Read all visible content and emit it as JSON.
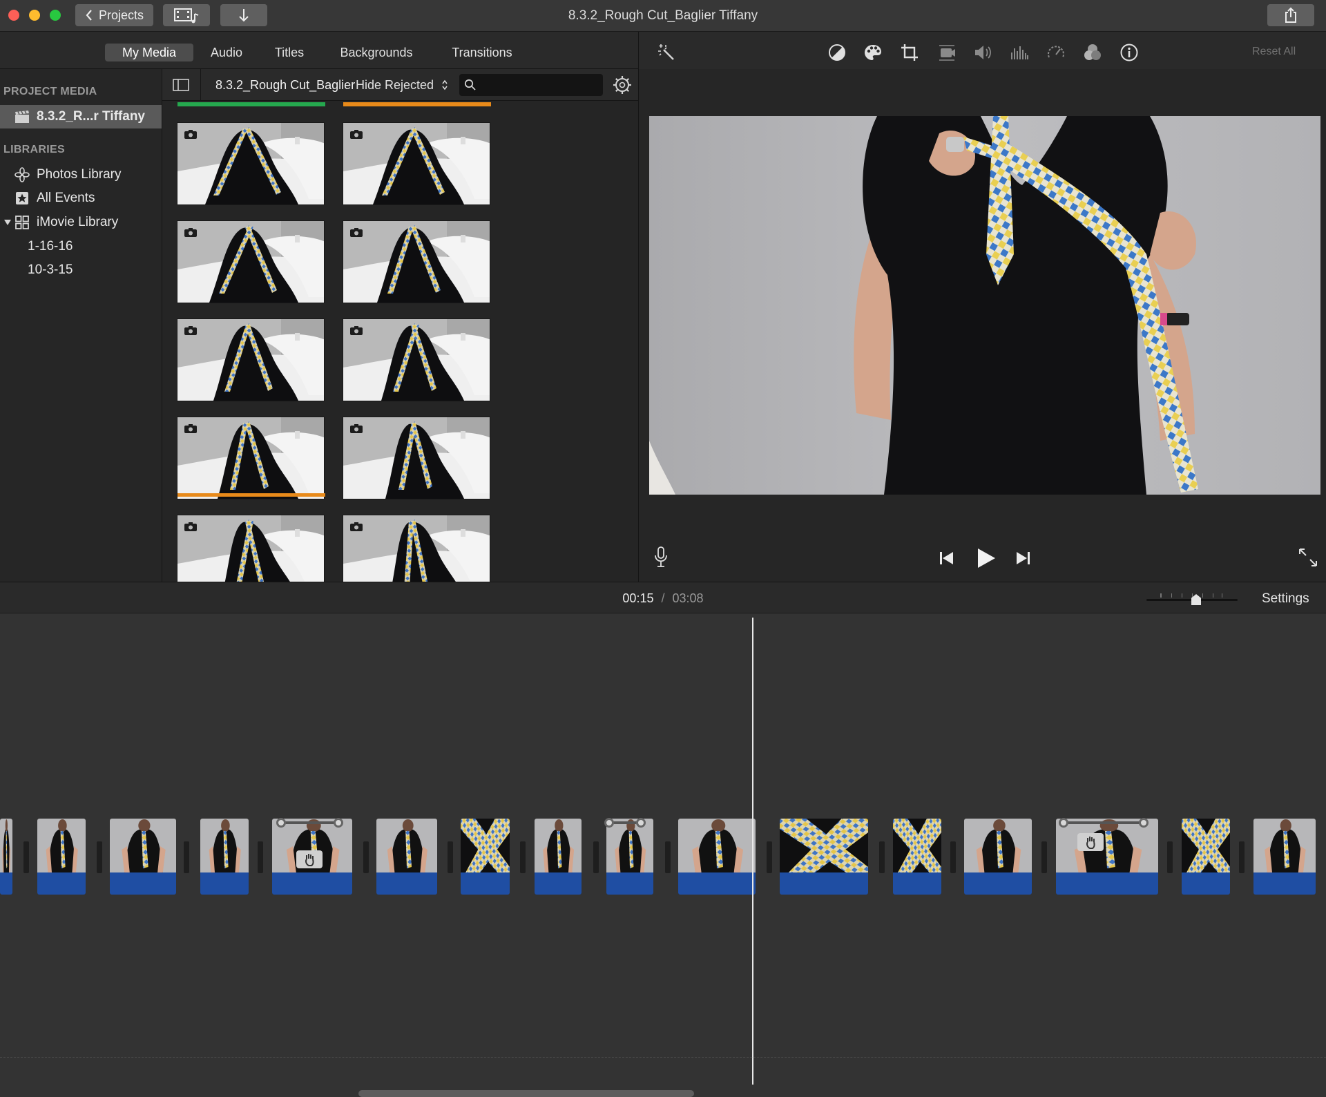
{
  "window": {
    "title": "8.3.2_Rough Cut_Baglier Tiffany",
    "projects_button": "Projects",
    "colors": {
      "close": "#fe5f57",
      "minimize": "#febc2e",
      "zoom": "#28c840"
    }
  },
  "media_tabs": [
    {
      "label": "My Media",
      "active": true
    },
    {
      "label": "Audio",
      "active": false
    },
    {
      "label": "Titles",
      "active": false
    },
    {
      "label": "Backgrounds",
      "active": false
    },
    {
      "label": "Transitions",
      "active": false
    }
  ],
  "sidebar": {
    "project_media_heading": "PROJECT MEDIA",
    "project_item": "8.3.2_R...r Tiffany",
    "libraries_heading": "LIBRARIES",
    "libraries": [
      {
        "label": "Photos Library",
        "icon": "photos-flower-icon"
      },
      {
        "label": "All Events",
        "icon": "star-icon"
      },
      {
        "label": "iMovie Library",
        "icon": "grid-icon"
      }
    ],
    "events": [
      "1-16-16",
      "10-3-15"
    ]
  },
  "browser": {
    "project_name": "8.3.2_Rough Cut_Baglier",
    "filter": "Hide Rejected",
    "search_placeholder": ""
  },
  "viewer_toolbar": {
    "reset_all": "Reset All",
    "icons": [
      "magic-wand-icon",
      "color-balance-icon",
      "color-palette-icon",
      "crop-icon",
      "stabilization-camera-icon",
      "volume-icon",
      "equalizer-icon",
      "speed-gauge-icon",
      "filter-circles-icon",
      "info-icon"
    ]
  },
  "timeline_bar": {
    "current_time": "00:15",
    "separator": "/",
    "total_time": "03:08",
    "settings": "Settings",
    "zoom_level": 0.55
  },
  "accent": {
    "audio_blue": "#1f4ea3",
    "marker_green": "#25a84e",
    "marker_orange": "#e88a1a"
  }
}
